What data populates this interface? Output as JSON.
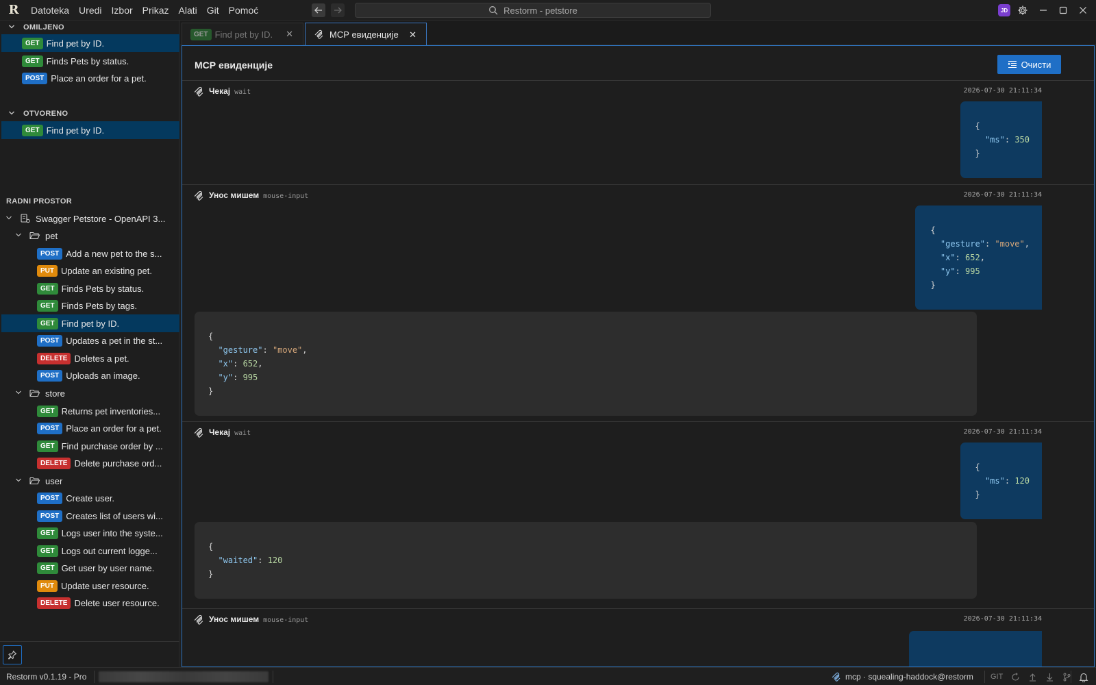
{
  "app": {
    "title": "Restorm - petstore",
    "logo": "R"
  },
  "menu": [
    "Datoteka",
    "Uredi",
    "Izbor",
    "Prikaz",
    "Alati",
    "Git",
    "Pomoć"
  ],
  "user": {
    "avatar_initials": "JD"
  },
  "sidebar": {
    "favorites": {
      "title": "OMILJENO",
      "items": [
        {
          "method": "GET",
          "label": "Find pet by ID."
        },
        {
          "method": "GET",
          "label": "Finds Pets by status."
        },
        {
          "method": "POST",
          "label": "Place an order for a pet."
        }
      ]
    },
    "open": {
      "title": "OTVORENO",
      "items": [
        {
          "method": "GET",
          "label": "Find pet by ID."
        }
      ]
    },
    "workspace": {
      "title": "RADNI PROSTOR",
      "collection": "Swagger Petstore - OpenAPI 3...",
      "folders": [
        {
          "name": "pet",
          "items": [
            {
              "method": "POST",
              "label": "Add a new pet to the s..."
            },
            {
              "method": "PUT",
              "label": "Update an existing pet."
            },
            {
              "method": "GET",
              "label": "Finds Pets by status."
            },
            {
              "method": "GET",
              "label": "Finds Pets by tags."
            },
            {
              "method": "GET",
              "label": "Find pet by ID."
            },
            {
              "method": "POST",
              "label": "Updates a pet in the st..."
            },
            {
              "method": "DELETE",
              "label": "Deletes a pet."
            },
            {
              "method": "POST",
              "label": "Uploads an image."
            }
          ]
        },
        {
          "name": "store",
          "items": [
            {
              "method": "GET",
              "label": "Returns pet inventories..."
            },
            {
              "method": "POST",
              "label": "Place an order for a pet."
            },
            {
              "method": "GET",
              "label": "Find purchase order by ..."
            },
            {
              "method": "DELETE",
              "label": "Delete purchase ord..."
            }
          ]
        },
        {
          "name": "user",
          "items": [
            {
              "method": "POST",
              "label": "Create user."
            },
            {
              "method": "POST",
              "label": "Creates list of users wi..."
            },
            {
              "method": "GET",
              "label": "Logs user into the syste..."
            },
            {
              "method": "GET",
              "label": "Logs out current logge..."
            },
            {
              "method": "GET",
              "label": "Get user by user name."
            },
            {
              "method": "PUT",
              "label": "Update user resource."
            },
            {
              "method": "DELETE",
              "label": "Delete user resource."
            }
          ]
        }
      ]
    }
  },
  "tabs": [
    {
      "method": "GET",
      "label": "Find pet by ID.",
      "active": false
    },
    {
      "label": "МСР евиденције",
      "active": true
    }
  ],
  "panel": {
    "title": "МСР евиденције",
    "clear_label": "Очисти",
    "entries": [
      {
        "name": "Чекај",
        "tool": "wait",
        "time": "2026-07-30 21:11:34",
        "request": [
          "{",
          "  \"ms\": 350",
          "}"
        ],
        "response": null
      },
      {
        "name": "Унос мишем",
        "tool": "mouse-input",
        "time": "2026-07-30 21:11:34",
        "request": [
          "{",
          "  \"gesture\": \"move\",",
          "  \"x\": 652,",
          "  \"y\": 995",
          "}"
        ],
        "response": [
          "{",
          "  \"gesture\": \"move\",",
          "  \"x\": 652,",
          "  \"y\": 995",
          "}"
        ]
      },
      {
        "name": "Чекај",
        "tool": "wait",
        "time": "2026-07-30 21:11:34",
        "request": [
          "{",
          "  \"ms\": 120",
          "}"
        ],
        "response": [
          "{",
          "  \"waited\": 120",
          "}"
        ]
      },
      {
        "name": "Унос мишем",
        "tool": "mouse-input",
        "time": "2026-07-30 21:11:34",
        "request": [],
        "response": null
      }
    ]
  },
  "status": {
    "version": "Restorm v0.1.19 - Pro",
    "mcp": "mcp · squealing-haddock@restorm",
    "git": "GIT"
  },
  "colors": {
    "accent": "#1f6fc6",
    "get": "#2f8a3a",
    "post": "#1f6fc6",
    "put": "#e08a0c",
    "delete": "#c7302f",
    "selection": "#04395e"
  },
  "icons": {
    "search": "search-icon",
    "settings": "gear-icon",
    "mcp": "mcp-icon",
    "folder": "folder-icon",
    "collection": "collection-icon",
    "pin": "pin-icon",
    "bell": "bell-icon",
    "clear": "clear-list-icon"
  }
}
